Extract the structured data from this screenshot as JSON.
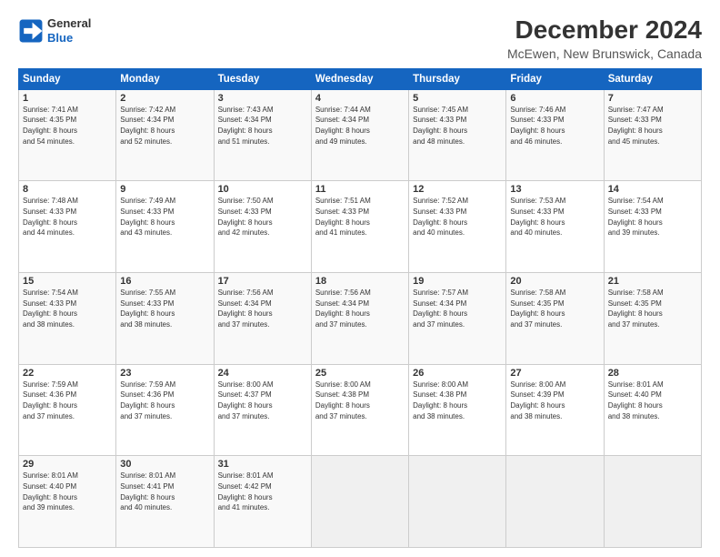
{
  "header": {
    "logo_line1": "General",
    "logo_line2": "Blue",
    "main_title": "December 2024",
    "subtitle": "McEwen, New Brunswick, Canada"
  },
  "weekdays": [
    "Sunday",
    "Monday",
    "Tuesday",
    "Wednesday",
    "Thursday",
    "Friday",
    "Saturday"
  ],
  "weeks": [
    [
      {
        "day": "1",
        "info": "Sunrise: 7:41 AM\nSunset: 4:35 PM\nDaylight: 8 hours\nand 54 minutes."
      },
      {
        "day": "2",
        "info": "Sunrise: 7:42 AM\nSunset: 4:34 PM\nDaylight: 8 hours\nand 52 minutes."
      },
      {
        "day": "3",
        "info": "Sunrise: 7:43 AM\nSunset: 4:34 PM\nDaylight: 8 hours\nand 51 minutes."
      },
      {
        "day": "4",
        "info": "Sunrise: 7:44 AM\nSunset: 4:34 PM\nDaylight: 8 hours\nand 49 minutes."
      },
      {
        "day": "5",
        "info": "Sunrise: 7:45 AM\nSunset: 4:33 PM\nDaylight: 8 hours\nand 48 minutes."
      },
      {
        "day": "6",
        "info": "Sunrise: 7:46 AM\nSunset: 4:33 PM\nDaylight: 8 hours\nand 46 minutes."
      },
      {
        "day": "7",
        "info": "Sunrise: 7:47 AM\nSunset: 4:33 PM\nDaylight: 8 hours\nand 45 minutes."
      }
    ],
    [
      {
        "day": "8",
        "info": "Sunrise: 7:48 AM\nSunset: 4:33 PM\nDaylight: 8 hours\nand 44 minutes."
      },
      {
        "day": "9",
        "info": "Sunrise: 7:49 AM\nSunset: 4:33 PM\nDaylight: 8 hours\nand 43 minutes."
      },
      {
        "day": "10",
        "info": "Sunrise: 7:50 AM\nSunset: 4:33 PM\nDaylight: 8 hours\nand 42 minutes."
      },
      {
        "day": "11",
        "info": "Sunrise: 7:51 AM\nSunset: 4:33 PM\nDaylight: 8 hours\nand 41 minutes."
      },
      {
        "day": "12",
        "info": "Sunrise: 7:52 AM\nSunset: 4:33 PM\nDaylight: 8 hours\nand 40 minutes."
      },
      {
        "day": "13",
        "info": "Sunrise: 7:53 AM\nSunset: 4:33 PM\nDaylight: 8 hours\nand 40 minutes."
      },
      {
        "day": "14",
        "info": "Sunrise: 7:54 AM\nSunset: 4:33 PM\nDaylight: 8 hours\nand 39 minutes."
      }
    ],
    [
      {
        "day": "15",
        "info": "Sunrise: 7:54 AM\nSunset: 4:33 PM\nDaylight: 8 hours\nand 38 minutes."
      },
      {
        "day": "16",
        "info": "Sunrise: 7:55 AM\nSunset: 4:33 PM\nDaylight: 8 hours\nand 38 minutes."
      },
      {
        "day": "17",
        "info": "Sunrise: 7:56 AM\nSunset: 4:34 PM\nDaylight: 8 hours\nand 37 minutes."
      },
      {
        "day": "18",
        "info": "Sunrise: 7:56 AM\nSunset: 4:34 PM\nDaylight: 8 hours\nand 37 minutes."
      },
      {
        "day": "19",
        "info": "Sunrise: 7:57 AM\nSunset: 4:34 PM\nDaylight: 8 hours\nand 37 minutes."
      },
      {
        "day": "20",
        "info": "Sunrise: 7:58 AM\nSunset: 4:35 PM\nDaylight: 8 hours\nand 37 minutes."
      },
      {
        "day": "21",
        "info": "Sunrise: 7:58 AM\nSunset: 4:35 PM\nDaylight: 8 hours\nand 37 minutes."
      }
    ],
    [
      {
        "day": "22",
        "info": "Sunrise: 7:59 AM\nSunset: 4:36 PM\nDaylight: 8 hours\nand 37 minutes."
      },
      {
        "day": "23",
        "info": "Sunrise: 7:59 AM\nSunset: 4:36 PM\nDaylight: 8 hours\nand 37 minutes."
      },
      {
        "day": "24",
        "info": "Sunrise: 8:00 AM\nSunset: 4:37 PM\nDaylight: 8 hours\nand 37 minutes."
      },
      {
        "day": "25",
        "info": "Sunrise: 8:00 AM\nSunset: 4:38 PM\nDaylight: 8 hours\nand 37 minutes."
      },
      {
        "day": "26",
        "info": "Sunrise: 8:00 AM\nSunset: 4:38 PM\nDaylight: 8 hours\nand 38 minutes."
      },
      {
        "day": "27",
        "info": "Sunrise: 8:00 AM\nSunset: 4:39 PM\nDaylight: 8 hours\nand 38 minutes."
      },
      {
        "day": "28",
        "info": "Sunrise: 8:01 AM\nSunset: 4:40 PM\nDaylight: 8 hours\nand 38 minutes."
      }
    ],
    [
      {
        "day": "29",
        "info": "Sunrise: 8:01 AM\nSunset: 4:40 PM\nDaylight: 8 hours\nand 39 minutes."
      },
      {
        "day": "30",
        "info": "Sunrise: 8:01 AM\nSunset: 4:41 PM\nDaylight: 8 hours\nand 40 minutes."
      },
      {
        "day": "31",
        "info": "Sunrise: 8:01 AM\nSunset: 4:42 PM\nDaylight: 8 hours\nand 41 minutes."
      },
      {
        "day": "",
        "info": ""
      },
      {
        "day": "",
        "info": ""
      },
      {
        "day": "",
        "info": ""
      },
      {
        "day": "",
        "info": ""
      }
    ]
  ]
}
